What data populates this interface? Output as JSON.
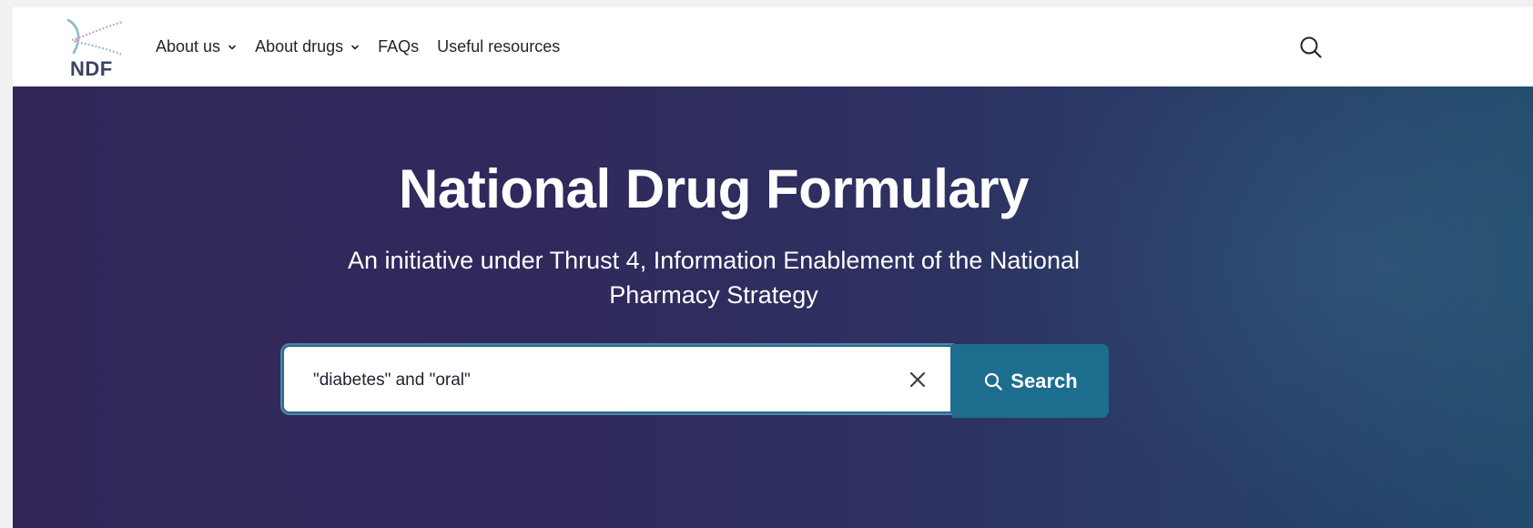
{
  "navbar": {
    "logo_text": "NDF",
    "items": [
      {
        "label": "About us",
        "has_dropdown": true
      },
      {
        "label": "About drugs",
        "has_dropdown": true
      },
      {
        "label": "FAQs",
        "has_dropdown": false
      },
      {
        "label": "Useful resources",
        "has_dropdown": false
      }
    ],
    "search_icon": "search-icon"
  },
  "hero": {
    "title": "National Drug Formulary",
    "subtitle": "An initiative under Thrust 4, Information Enablement of the National Pharmacy Strategy"
  },
  "search": {
    "value": "\"diabetes\" and \"oral\"",
    "clear_icon": "close-icon",
    "button_label": "Search",
    "button_icon": "search-icon"
  },
  "colors": {
    "accent": "#1d6e8e",
    "hero_start": "#332759",
    "hero_end": "#224b6c",
    "nav_text": "#1f2430"
  }
}
